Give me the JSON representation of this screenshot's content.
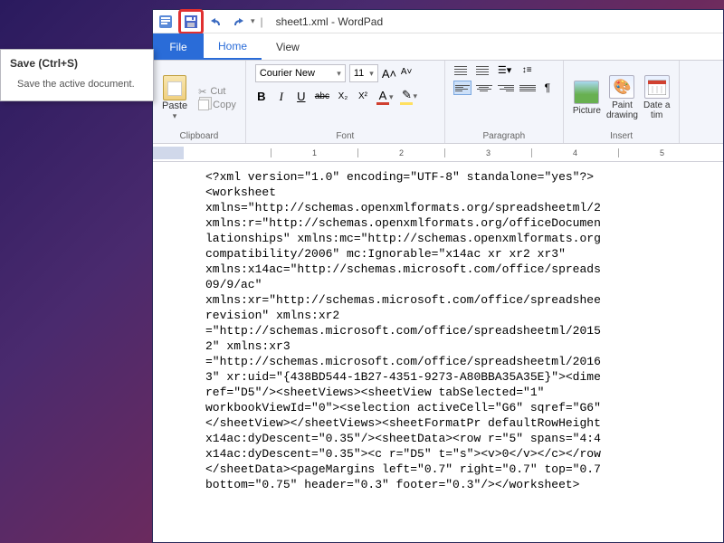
{
  "tooltip": {
    "title": "Save (Ctrl+S)",
    "body": "Save the active document."
  },
  "titlebar": {
    "separator": "|",
    "title": "sheet1.xml - WordPad"
  },
  "tabs": {
    "file": "File",
    "home": "Home",
    "view": "View"
  },
  "ribbon": {
    "clipboard": {
      "paste": "Paste",
      "cut": "Cut",
      "copy": "Copy",
      "label": "Clipboard"
    },
    "font": {
      "name": "Courier New",
      "size": "11",
      "grow": "A˄",
      "shrink": "A˅",
      "bold": "B",
      "italic": "I",
      "underline": "U",
      "strike": "abc",
      "sub": "X₂",
      "sup": "X²",
      "color": "A",
      "highlight": "✎",
      "label": "Font"
    },
    "paragraph": {
      "bullets": "☰▾",
      "spacing": "↕≡",
      "para_icon": "¶",
      "label": "Paragraph"
    },
    "insert": {
      "picture": "Picture",
      "paint": "Paint\ndrawing",
      "datetime": "Date a\ntim",
      "label": "Insert"
    }
  },
  "ruler": {
    "marks": [
      "1",
      "2",
      "3",
      "4",
      "5"
    ]
  },
  "document": {
    "content": "<?xml version=\"1.0\" encoding=\"UTF-8\" standalone=\"yes\"?>\n<worksheet\nxmlns=\"http://schemas.openxmlformats.org/spreadsheetml/2\nxmlns:r=\"http://schemas.openxmlformats.org/officeDocumen\nlationships\" xmlns:mc=\"http://schemas.openxmlformats.org\ncompatibility/2006\" mc:Ignorable=\"x14ac xr xr2 xr3\"\nxmlns:x14ac=\"http://schemas.microsoft.com/office/spreads\n09/9/ac\"\nxmlns:xr=\"http://schemas.microsoft.com/office/spreadshee\nrevision\" xmlns:xr2\n=\"http://schemas.microsoft.com/office/spreadsheetml/2015\n2\" xmlns:xr3\n=\"http://schemas.microsoft.com/office/spreadsheetml/2016\n3\" xr:uid=\"{438BD544-1B27-4351-9273-A80BBA35A35E}\"><dime\nref=\"D5\"/><sheetViews><sheetView tabSelected=\"1\"\nworkbookViewId=\"0\"><selection activeCell=\"G6\" sqref=\"G6\"\n</sheetView></sheetViews><sheetFormatPr defaultRowHeight\nx14ac:dyDescent=\"0.35\"/><sheetData><row r=\"5\" spans=\"4:4\nx14ac:dyDescent=\"0.35\"><c r=\"D5\" t=\"s\"><v>0</v></c></row\n</sheetData><pageMargins left=\"0.7\" right=\"0.7\" top=\"0.7\nbottom=\"0.75\" header=\"0.3\" footer=\"0.3\"/></worksheet>"
  }
}
